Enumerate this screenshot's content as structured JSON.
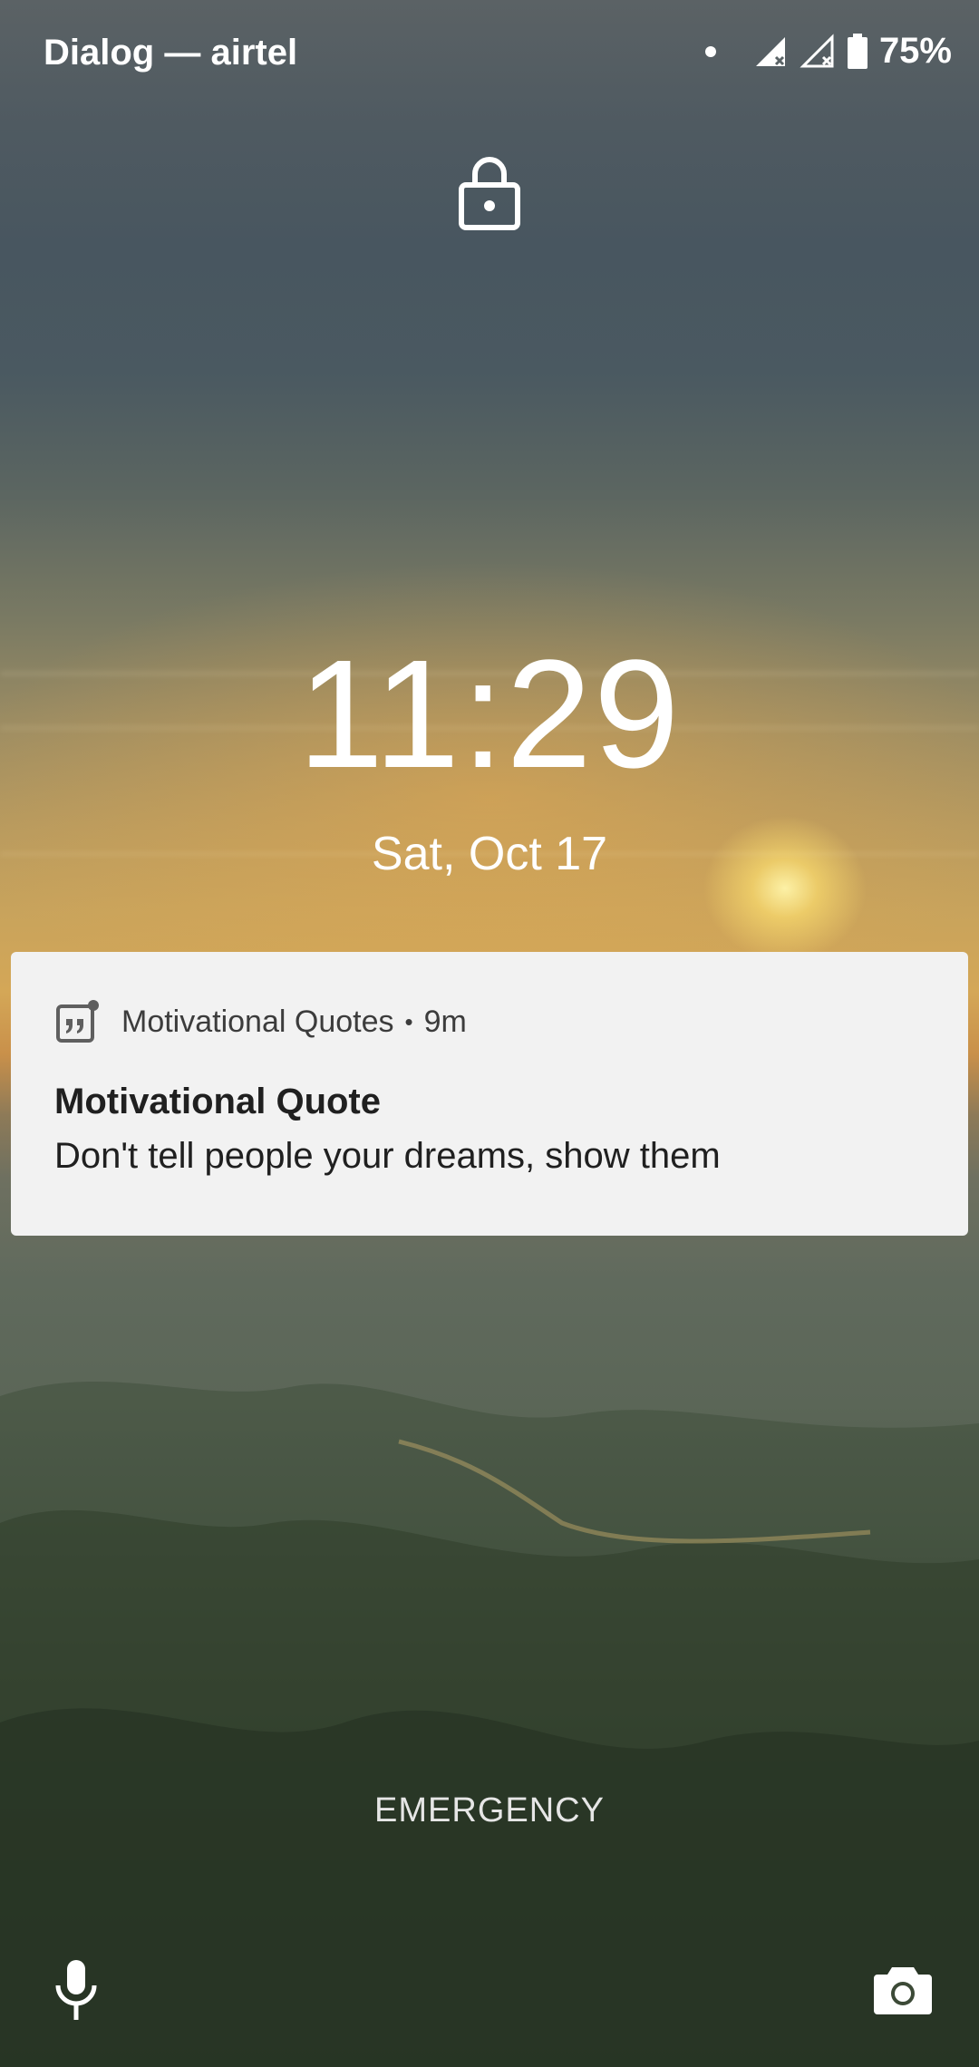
{
  "status_bar": {
    "carrier": "Dialog — airtel",
    "battery": "75%",
    "icons": [
      "notification-dot-icon",
      "signal-no-data-icon",
      "signal-no-data-icon",
      "battery-icon"
    ]
  },
  "lock": {
    "icon": "lock-icon"
  },
  "clock": {
    "time": "11:29",
    "date": "Sat, Oct 17"
  },
  "notification": {
    "app_icon": "quote-icon",
    "app_name": "Motivational Quotes",
    "separator": "•",
    "age": "9m",
    "title": "Motivational Quote",
    "body": "Don't tell people your dreams, show them",
    "background": "#f2f2f2"
  },
  "bottom": {
    "emergency_label": "EMERGENCY",
    "left_icon": "microphone-icon",
    "right_icon": "camera-icon"
  }
}
